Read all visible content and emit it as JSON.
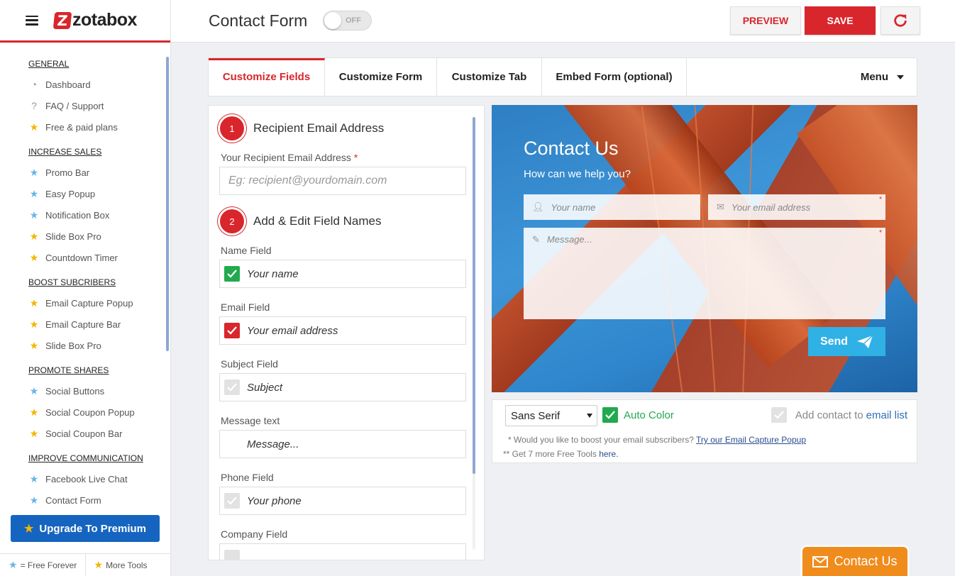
{
  "sidebar": {
    "logo_text": "zotabox",
    "sections": [
      {
        "title": "GENERAL",
        "items": [
          {
            "label": "Dashboard",
            "icon": "dashboard-icon"
          },
          {
            "label": "FAQ / Support",
            "icon": "question-icon"
          },
          {
            "label": "Free & paid plans",
            "icon": "star-gold-icon"
          }
        ]
      },
      {
        "title": "INCREASE SALES",
        "items": [
          {
            "label": "Promo Bar",
            "icon": "star-blue-icon"
          },
          {
            "label": "Easy Popup",
            "icon": "star-blue-icon"
          },
          {
            "label": "Notification Box",
            "icon": "star-blue-icon"
          },
          {
            "label": "Slide Box Pro",
            "icon": "star-gold-icon"
          },
          {
            "label": "Countdown Timer",
            "icon": "star-gold-icon"
          }
        ]
      },
      {
        "title": "BOOST SUBCRIBERS",
        "items": [
          {
            "label": "Email Capture Popup",
            "icon": "star-gold-icon"
          },
          {
            "label": "Email Capture Bar",
            "icon": "star-gold-icon"
          },
          {
            "label": "Slide Box Pro",
            "icon": "star-gold-icon"
          }
        ]
      },
      {
        "title": "PROMOTE SHARES",
        "items": [
          {
            "label": "Social Buttons",
            "icon": "star-blue-icon"
          },
          {
            "label": "Social Coupon Popup",
            "icon": "star-gold-icon"
          },
          {
            "label": "Social Coupon Bar",
            "icon": "star-gold-icon"
          }
        ]
      },
      {
        "title": "IMPROVE COMMUNICATION",
        "items": [
          {
            "label": "Facebook Live Chat",
            "icon": "star-blue-icon"
          },
          {
            "label": "Contact Form",
            "icon": "star-blue-icon"
          }
        ]
      }
    ],
    "upgrade_label": "Upgrade To Premium",
    "footer": {
      "free_forever": "= Free Forever",
      "more_tools": "More Tools"
    }
  },
  "topbar": {
    "title": "Contact Form",
    "toggle_label": "OFF",
    "preview_label": "PREVIEW",
    "save_label": "SAVE"
  },
  "tabs": [
    {
      "label": "Customize Fields",
      "active": true
    },
    {
      "label": "Customize Form",
      "active": false
    },
    {
      "label": "Customize Tab",
      "active": false
    },
    {
      "label": "Embed Form (optional)",
      "active": false
    }
  ],
  "tab_menu_label": "Menu",
  "fields_panel": {
    "step1": {
      "num": "1",
      "title": "Recipient Email Address"
    },
    "recipient_label": "Your Recipient Email Address",
    "recipient_required": "*",
    "recipient_placeholder": "Eg: recipient@yourdomain.com",
    "step2": {
      "num": "2",
      "title": "Add & Edit Field Names"
    },
    "fields": [
      {
        "label": "Name Field",
        "value": "Your name",
        "check": "green"
      },
      {
        "label": "Email Field",
        "value": "Your email address",
        "check": "red"
      },
      {
        "label": "Subject Field",
        "value": "Subject",
        "check": "grey"
      },
      {
        "label": "Message text",
        "value": "Message...",
        "check": "none"
      },
      {
        "label": "Phone Field",
        "value": "Your phone",
        "check": "grey"
      },
      {
        "label": "Company Field",
        "value": "",
        "check": "grey"
      }
    ]
  },
  "form_preview": {
    "title": "Contact Us",
    "subtitle": "How can we help you?",
    "name_placeholder": "Your name",
    "email_placeholder": "Your email address",
    "message_placeholder": "Message...",
    "required_mark": "*",
    "send_label": "Send"
  },
  "options": {
    "font_select": "Sans Serif",
    "auto_color_label": "Auto Color",
    "add_contact_text": "Add contact to",
    "add_contact_link": "email list",
    "note1_text": "* Would you like to boost your email subscribers?",
    "note1_link": "Try our Email Capture Popup",
    "note2_text": "** Get 7 more Free Tools",
    "note2_link": "here."
  },
  "float_tab_label": "Contact Us",
  "colors": {
    "brand_red": "#d8262c",
    "accent_blue": "#1565c0",
    "send_blue": "#2fb1e6",
    "float_orange": "#f08c1c",
    "check_green": "#22a94f"
  }
}
